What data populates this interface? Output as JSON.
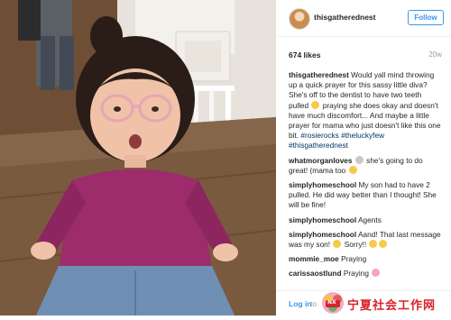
{
  "post": {
    "username": "thisgatherednest",
    "follow_label": "Follow",
    "likes": "674 likes",
    "age": "20w"
  },
  "comments": [
    {
      "user": "thisgatherednest",
      "text": "Would yall mind throwing up a quick prayer for this sassy little diva? She's off to the dentist to have two teeth pulled",
      "text_after_emoji": "praying she does okay and doesn't have much discomfort... And maybe a little prayer for mama who just doesn't like this one bit.",
      "hashtags": "#rosierocks #theluckyfew #thisgatherednest"
    },
    {
      "user": "whatmorganloves",
      "text": "she's going to do great! (mama too"
    },
    {
      "user": "simplyhomeschool",
      "text": "My son had to have 2 pulled. He did way better than I thought! She will be fine!"
    },
    {
      "user": "simplyhomeschool",
      "text": "Agents"
    },
    {
      "user": "simplyhomeschool",
      "text": "Aand! That last message was my son!",
      "text_after_emoji": "Sorry!!"
    },
    {
      "user": "mommie_moe",
      "text": "Praying"
    },
    {
      "user": "carissaostlund",
      "text": "Praying"
    }
  ],
  "footer": {
    "login_label": "Log in",
    "login_suffix": "to"
  },
  "watermark": {
    "badge": "NX",
    "text": "宁夏社会工作网"
  },
  "colors": {
    "link_blue": "#3897f0",
    "hashtag_blue": "#003569",
    "sweater_magenta": "#9c2c6b"
  },
  "icons": [
    "avatar",
    "emoji-pray",
    "emoji-heart"
  ]
}
